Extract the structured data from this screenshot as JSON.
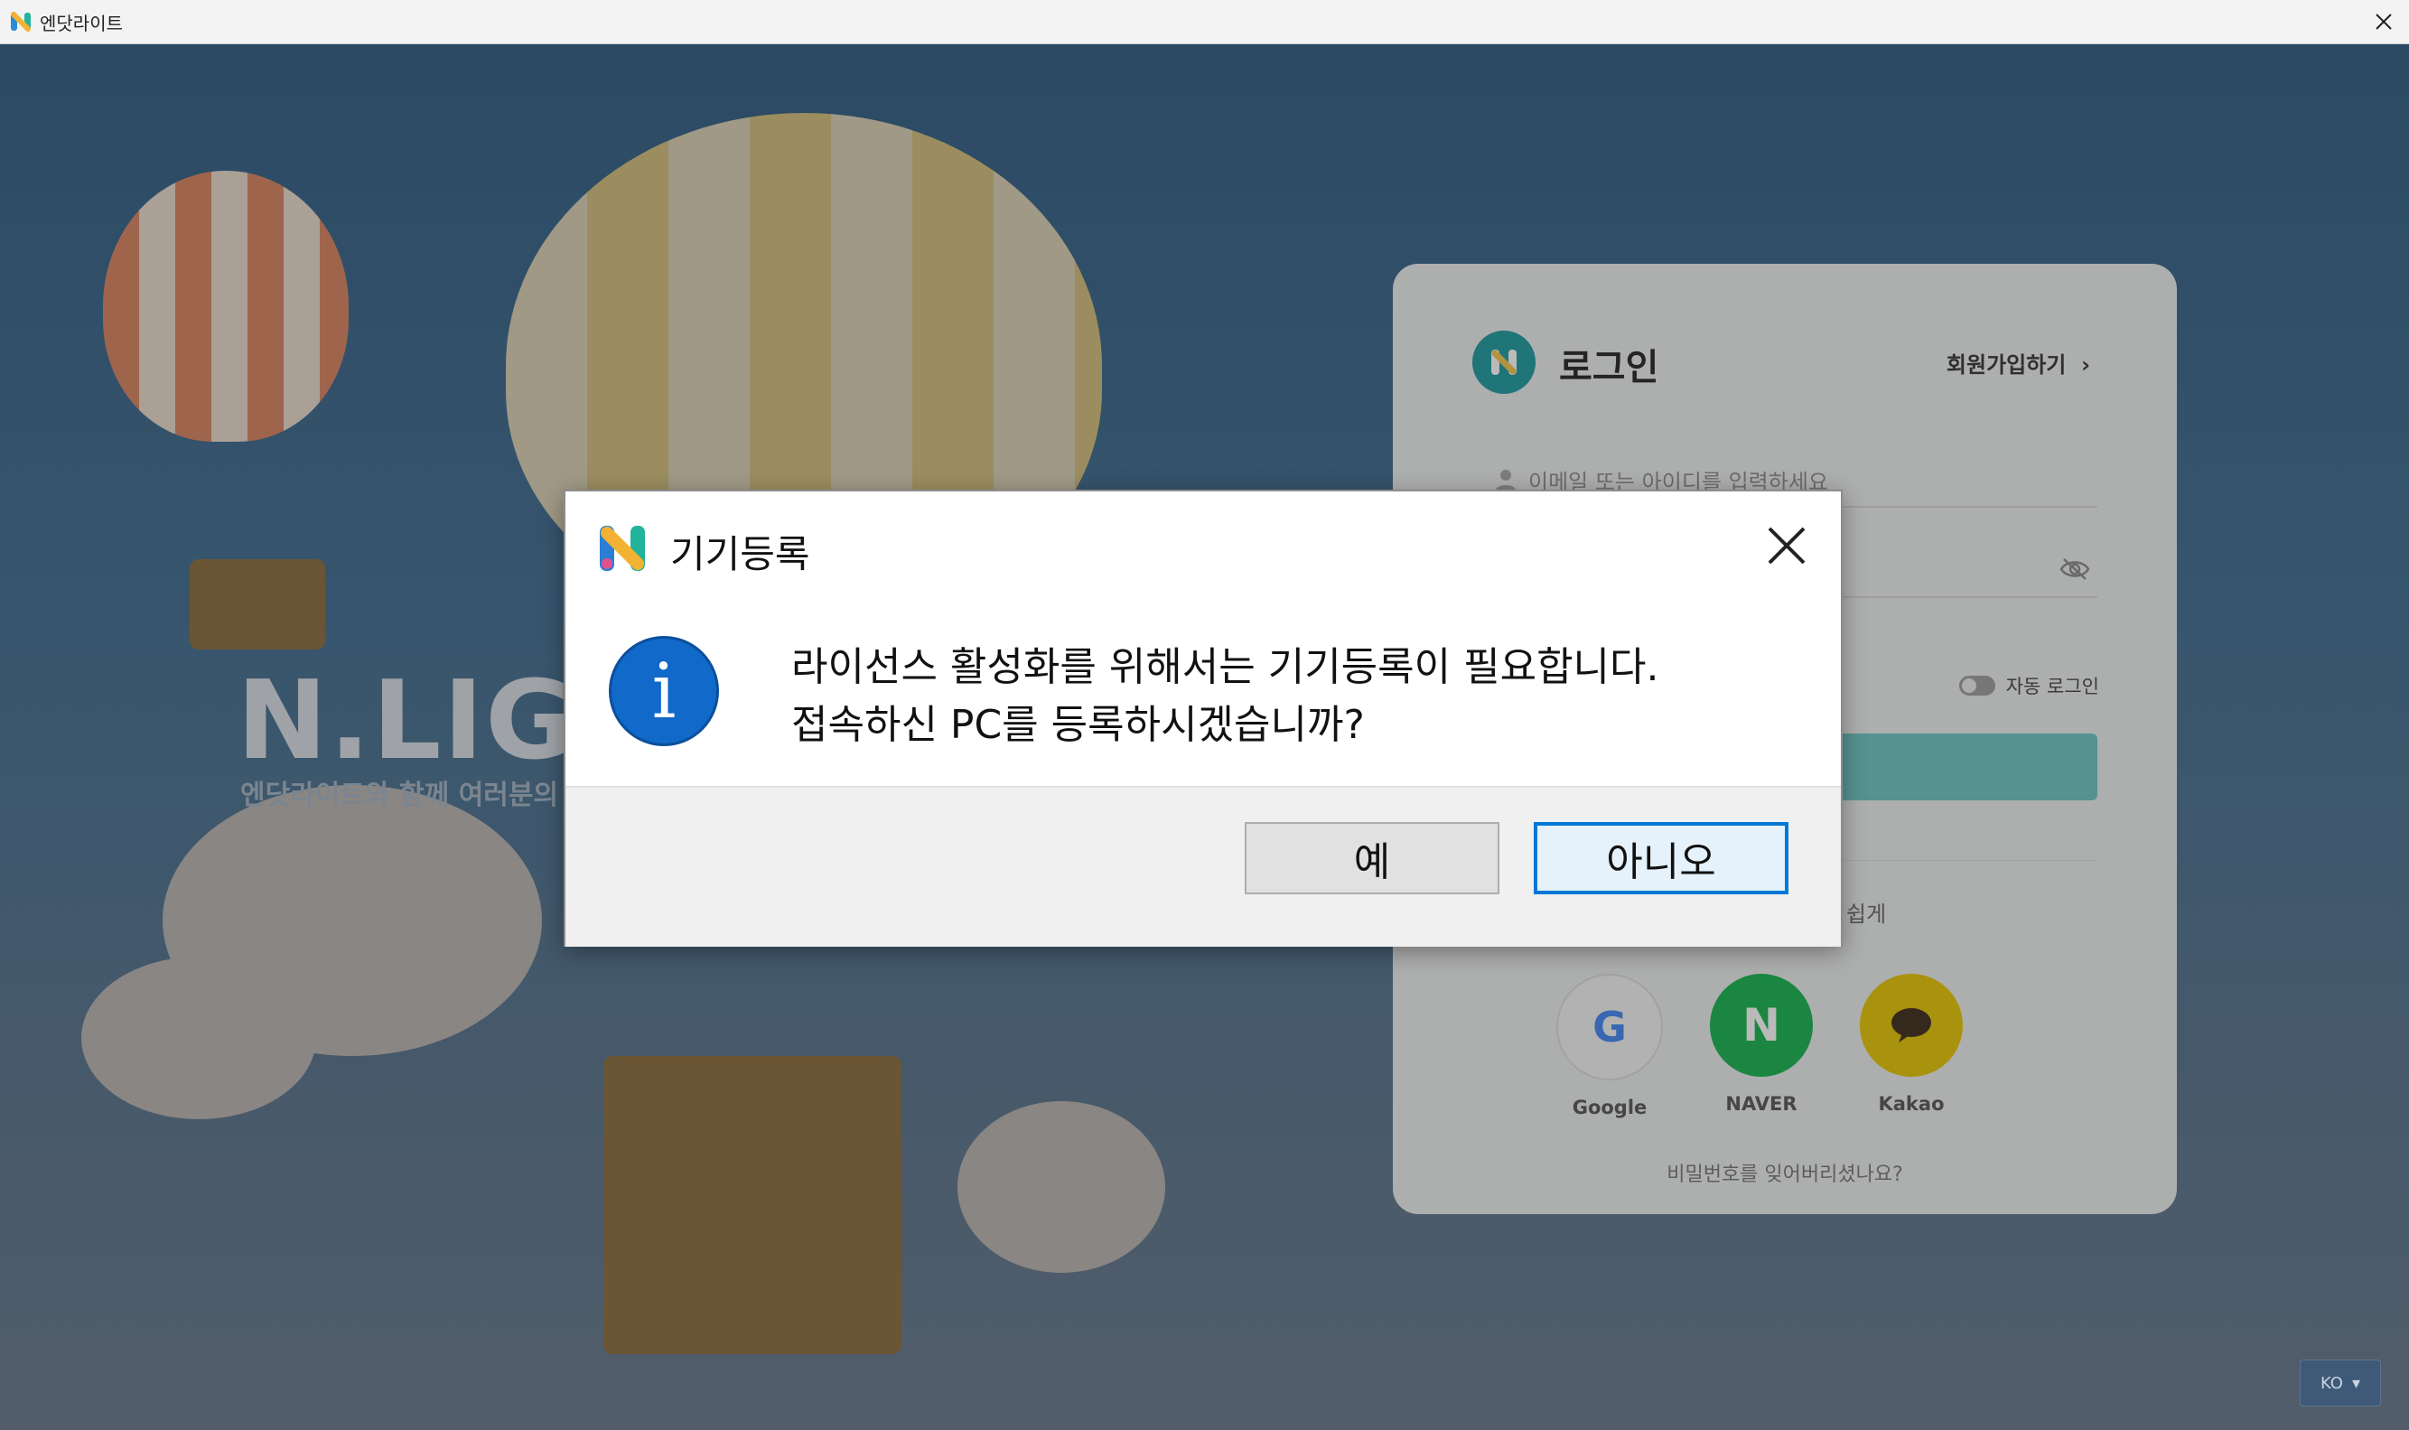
{
  "window": {
    "title": "엔닷라이트",
    "close_icon": "close-icon"
  },
  "background": {
    "brand_logo": "N.LIGI",
    "brand_subtitle": "엔닷라이트와 함께 여러분의"
  },
  "login": {
    "title": "로그인",
    "signup_link": "회원가입하기",
    "email_placeholder": "이메일 또는 아이디를 입력하세요",
    "auto_login": "자동 로그인",
    "easy_login_text": "쉽게",
    "social": [
      {
        "label": "Google",
        "color": "#f4f4f4"
      },
      {
        "label": "NAVER",
        "color": "#14b34e"
      },
      {
        "label": "Kakao",
        "color": "#e6c400"
      }
    ],
    "forgot_password": "비밀번호를 잊어버리셨나요?"
  },
  "language": {
    "selected": "KO"
  },
  "dialog": {
    "title": "기기등록",
    "message_line1": "라이선스 활성화를 위해서는 기기등록이 필요합니다.",
    "message_line2": "접속하신 PC를 등록하시겠습니까?",
    "info_glyph": "i",
    "yes_label": "예",
    "no_label": "아니오",
    "accent_color": "#0078d7"
  }
}
